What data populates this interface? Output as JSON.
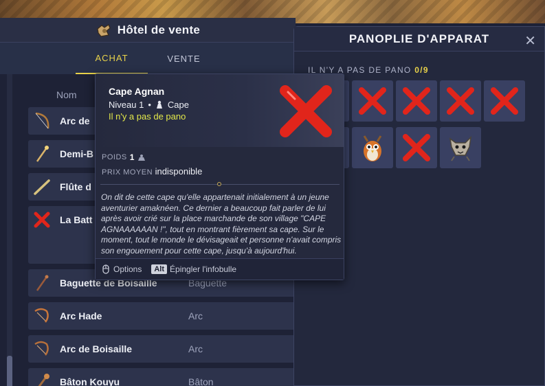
{
  "hdv": {
    "title": "Hôtel de vente",
    "tabs": [
      {
        "label": "ACHAT",
        "active": true
      },
      {
        "label": "VENTE",
        "active": false
      }
    ],
    "column_name": "Nom",
    "rows": [
      {
        "name": "Arc de",
        "type": "",
        "icon": "bow-icon"
      },
      {
        "name": "Demi-B",
        "type": "",
        "icon": "wand-icon"
      },
      {
        "name": "Flûte d",
        "type": "",
        "icon": "flute-icon"
      },
      {
        "name": "La Batt",
        "type": "",
        "icon": "cross-icon"
      },
      {
        "name": "Baguette de Boisaille",
        "type": "Baguette",
        "icon": "wand-icon"
      },
      {
        "name": "Arc Hade",
        "type": "Arc",
        "icon": "bow-icon"
      },
      {
        "name": "Arc de Boisaille",
        "type": "Arc",
        "icon": "bow-icon"
      },
      {
        "name": "Bâton Kouyu",
        "type": "Bâton",
        "icon": "staff-icon"
      }
    ]
  },
  "panoplie": {
    "title": "PANOPLIE D'APPARAT",
    "status_text": "IL N'Y A PAS DE PANO",
    "count": "0/9",
    "slots": [
      "cross-icon",
      "cross-icon",
      "cross-icon",
      "cross-icon",
      "cross-icon",
      "owl-icon",
      "cross-icon",
      "wolf-icon"
    ]
  },
  "tooltip": {
    "name": "Cape Agnan",
    "level": "Niveau 1",
    "bullet": "•",
    "type": "Cape",
    "pano": "Il n'y a pas de pano",
    "poids_label": "POIDS",
    "poids_value": "1",
    "prix_label": "PRIX MOYEN",
    "prix_value": "indisponible",
    "description": "On dit de cette cape qu'elle appartenait initialement à un jeune aventurier amaknéen. Ce dernier a beaucoup fait parler de lui après avoir crié sur la place marchande de son village \"CAPE AGNAAAAAAN !\", tout en montrant fièrement sa cape. Sur le moment, tout le monde le dévisageait et personne n'avait compris son engouement pour cette cape, jusqu'à aujourd'hui.",
    "options_label": "Options",
    "alt_key": "Alt",
    "pin_label": "Épingler l'infobulle"
  },
  "colors": {
    "accent": "#e8d24a",
    "cross": "#e1251b"
  }
}
